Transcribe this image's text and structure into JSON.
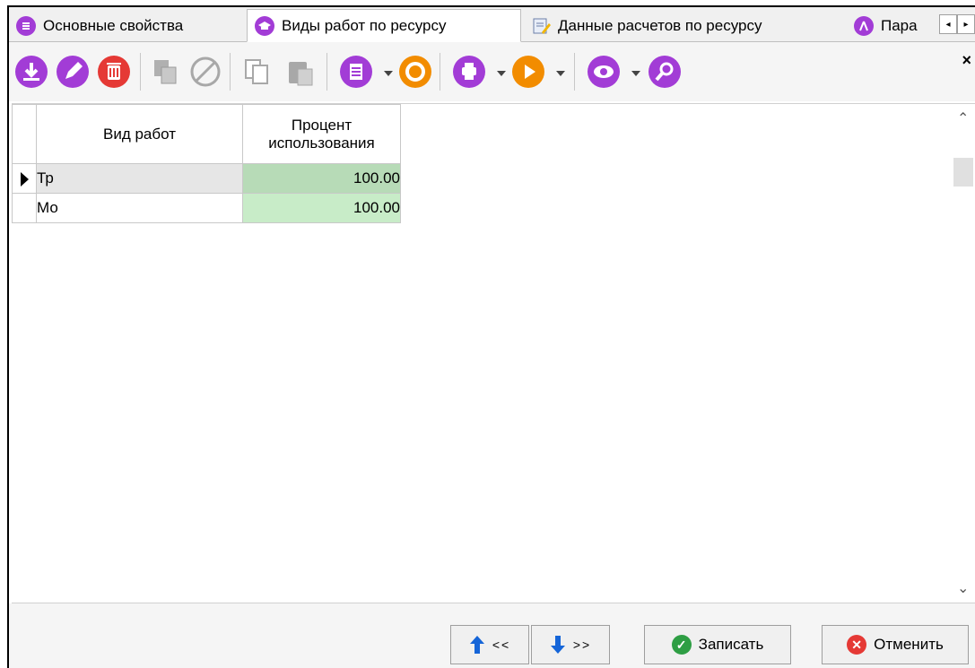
{
  "tabs": [
    {
      "label": "Основные свойства",
      "icon": "list-icon",
      "active": false
    },
    {
      "label": "Виды работ по ресурсу",
      "icon": "graduation-cap-icon",
      "active": true
    },
    {
      "label": "Данные расчетов по ресурсу",
      "icon": "edit-notepad-icon",
      "active": false
    },
    {
      "label": "Пара",
      "icon": "compass-icon",
      "active": false
    }
  ],
  "tab_scroll": {
    "left": "◂",
    "right": "▸"
  },
  "toolbar": {
    "close_glyph": "×",
    "icons": [
      "download-icon",
      "edit-icon",
      "delete-icon",
      "copy-record-icon",
      "cancel-icon",
      "copy-icon",
      "paste-icon",
      "document-icon",
      "refresh-icon",
      "print-icon",
      "play-icon",
      "view-icon",
      "search-icon"
    ]
  },
  "grid": {
    "columns": [
      "Вид работ",
      "Процент использования"
    ],
    "column2_line1": "Процент",
    "column2_line2": "использования",
    "rows": [
      {
        "work_type": "Тр",
        "percent": "100.00",
        "selected": true
      },
      {
        "work_type": "Мо",
        "percent": "100.00",
        "selected": false
      }
    ]
  },
  "footer": {
    "prev_label": "<<",
    "next_label": ">>",
    "save_label": "Записать",
    "cancel_label": "Отменить"
  },
  "colors": {
    "accent_purple": "#a23cd6",
    "accent_orange": "#f28c00",
    "accent_red": "#e53935",
    "save_green": "#2e9e44",
    "cell_green": "#c8ecc8"
  }
}
